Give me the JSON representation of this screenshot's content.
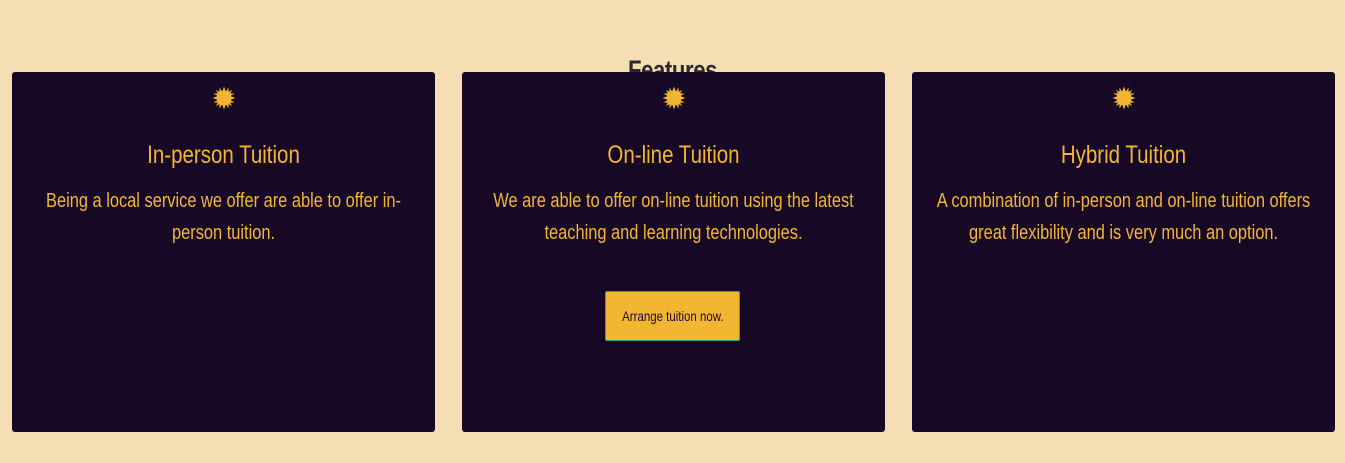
{
  "section": {
    "title": "Features"
  },
  "cards": [
    {
      "icon": "sun-icon",
      "title": "In-person Tuition",
      "text": "Being a local service we offer are able to offer in-person tuition."
    },
    {
      "icon": "sun-icon",
      "title": "On-line Tuition",
      "text": "We are able to offer on-line tuition using the latest teaching and learning technologies.",
      "button_label": "Arrange tuition now."
    },
    {
      "icon": "sun-icon",
      "title": "Hybrid Tuition",
      "text": "A combination of in-person and on-line tuition offers great flexibility and is very much an option."
    }
  ],
  "colors": {
    "page_background": "#f5deb3",
    "card_background": "#170826",
    "accent": "#f2b632",
    "button_border": "#2aa58a"
  }
}
